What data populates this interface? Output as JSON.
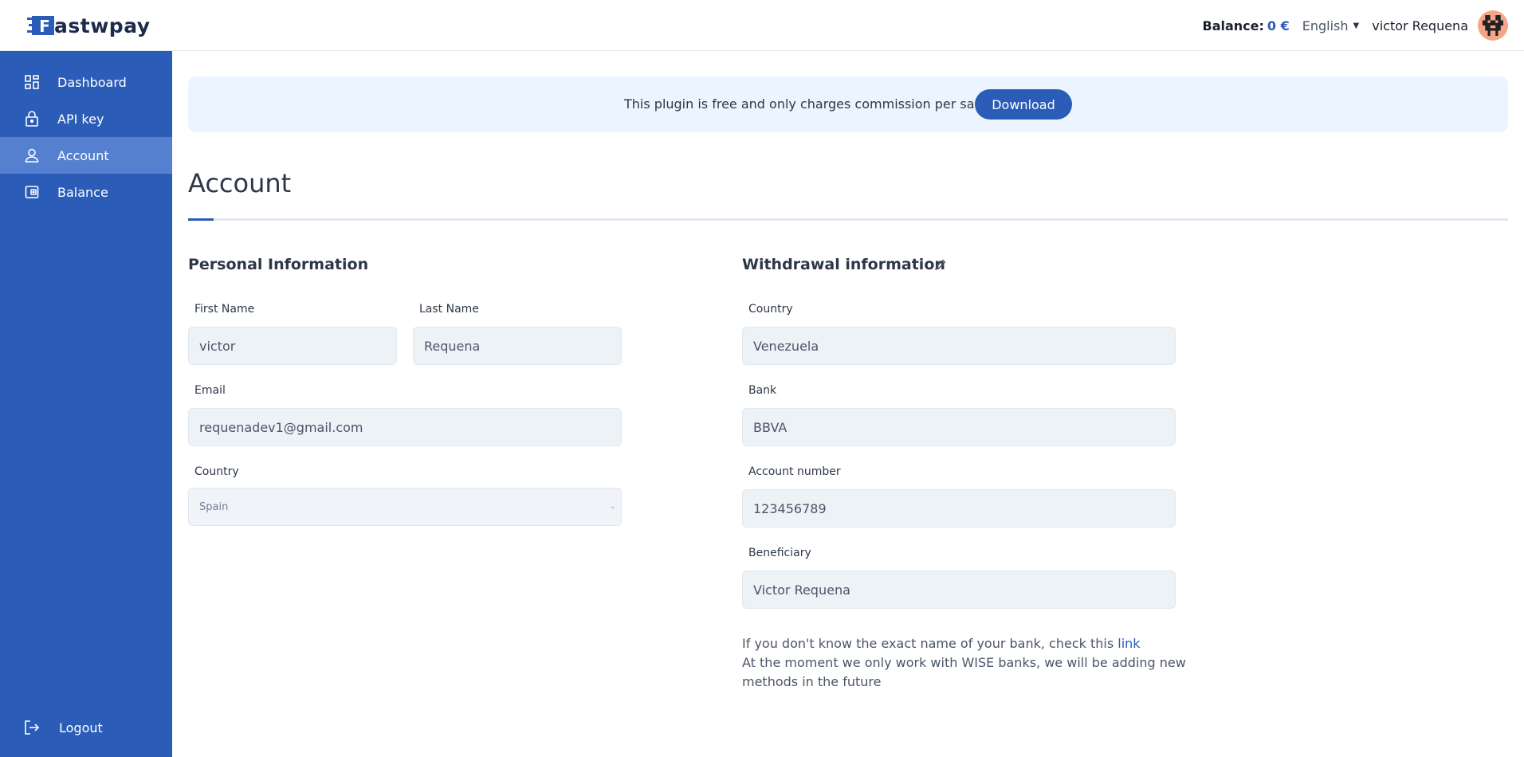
{
  "header": {
    "logo_text": "Fastwpay",
    "logo_letter": "F",
    "balance_label": "Balance:",
    "balance_value": "0 €",
    "language": "English",
    "user_name": "victor Requena"
  },
  "sidebar": {
    "items": [
      {
        "label": "Dashboard",
        "icon": "dashboard-icon"
      },
      {
        "label": "API key",
        "icon": "lock-icon"
      },
      {
        "label": "Account",
        "icon": "user-icon",
        "active": true
      },
      {
        "label": "Balance",
        "icon": "wallet-icon"
      }
    ],
    "logout_label": "Logout"
  },
  "banner": {
    "text": "This plugin is free and only charges commission per sale",
    "button_label": "Download"
  },
  "page": {
    "title": "Account"
  },
  "personal": {
    "section_title": "Personal Information",
    "first_name_label": "First Name",
    "first_name_value": "victor",
    "last_name_label": "Last Name",
    "last_name_value": "Requena",
    "email_label": "Email",
    "email_value": "requenadev1@gmail.com",
    "country_label": "Country",
    "country_value": "Spain"
  },
  "withdrawal": {
    "section_title": "Withdrawal information",
    "country_label": "Country",
    "country_value": "Venezuela",
    "bank_label": "Bank",
    "bank_value": "BBVA",
    "account_label": "Account number",
    "account_value": "123456789",
    "beneficiary_label": "Beneficiary",
    "beneficiary_value": "Victor Requena",
    "note_line1": "If you don't know the exact name of your bank, check this",
    "note_link": "link",
    "note_line2": "At the moment we only work with WISE banks, we will be adding new",
    "note_line3": "methods in the future"
  },
  "colors": {
    "primary": "#2b5cb8",
    "sidebar_active": "#5580cf",
    "banner_bg": "#ebf4ff",
    "field_bg": "#edf2f7"
  }
}
